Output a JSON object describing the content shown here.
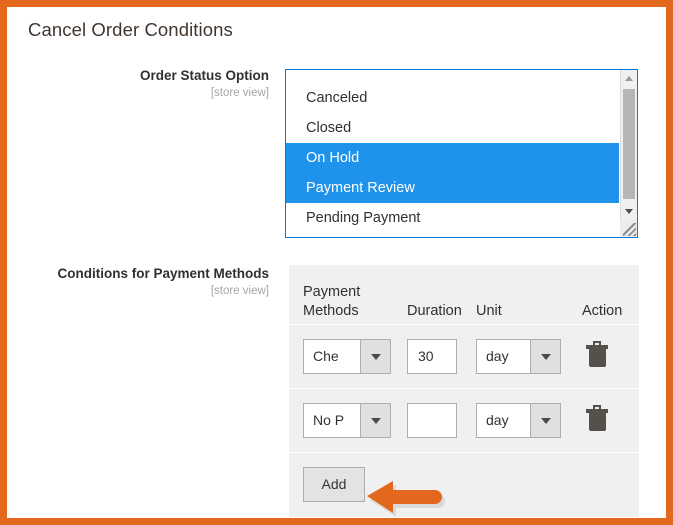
{
  "colors": {
    "frame_orange": "#e2681e",
    "annotation_arrow": "#e2681e",
    "selection_blue": "#1f93ec",
    "listbox_border": "#007bdb",
    "table_bg": "#f0f0f0",
    "label_text": "#303030",
    "scope_text": "#a6a6a6",
    "title_text": "#41362f"
  },
  "section": {
    "title": "Cancel Order Conditions"
  },
  "order_status_field": {
    "label": "Order Status Option",
    "scope": "[store view]",
    "options": [
      {
        "label": "Canceled",
        "selected": false
      },
      {
        "label": "Closed",
        "selected": false
      },
      {
        "label": "On Hold",
        "selected": true
      },
      {
        "label": "Payment Review",
        "selected": true
      },
      {
        "label": "Pending Payment",
        "selected": false
      }
    ],
    "scrollbar": {
      "up_icon": "triangle-up-icon",
      "down_icon": "triangle-down-icon",
      "resize_icon": "resize-grip-icon"
    }
  },
  "conditions_field": {
    "label": "Conditions for Payment Methods",
    "scope": "[store view]",
    "columns": [
      "Payment Methods",
      "Duration",
      "Unit",
      "Action"
    ],
    "rows": [
      {
        "payment_method": "Che",
        "duration": "30",
        "unit": "day",
        "delete_icon": "trash-icon",
        "dropdown_icon": "chevron-down-icon"
      },
      {
        "payment_method": "No P",
        "duration": "",
        "unit": "day",
        "delete_icon": "trash-icon",
        "dropdown_icon": "chevron-down-icon"
      }
    ],
    "add_button": "Add"
  },
  "annotation": {
    "arrow_icon": "arrow-left-icon"
  }
}
